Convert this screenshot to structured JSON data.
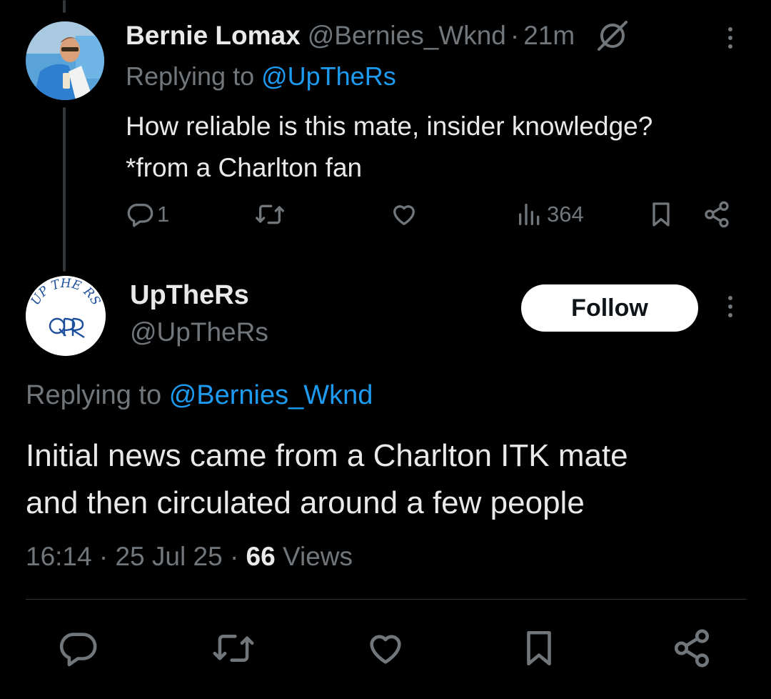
{
  "reply": {
    "name": "Bernie Lomax",
    "handle": "@Bernies_Wknd",
    "time": "21m",
    "replying_prefix": "Replying to",
    "replying_to": "@UpTheRs",
    "text_line1": "How reliable is this mate, insider knowledge?",
    "text_line2": "*from a Charlton fan",
    "reply_count": "1",
    "views": "364"
  },
  "main": {
    "name": "UpTheRs",
    "handle": "@UpTheRs",
    "follow_label": "Follow",
    "replying_prefix": "Replying to",
    "replying_to": "@Bernies_Wknd",
    "text_line1": "Initial news came from a Charlton ITK mate",
    "text_line2": "and then circulated around a few people",
    "time": "16:14",
    "date": "25 Jul 25",
    "views_count": "66",
    "views_label": "Views"
  },
  "avatar_logo_text": "UP THE RS",
  "colors": {
    "background": "#000000",
    "text": "#e7e9ea",
    "muted": "#71767b",
    "link": "#1d9bf0",
    "divider": "#2f3336"
  },
  "icons": [
    "grok-icon",
    "more-icon",
    "reply-icon",
    "retweet-icon",
    "like-icon",
    "views-icon",
    "bookmark-icon",
    "share-icon"
  ]
}
